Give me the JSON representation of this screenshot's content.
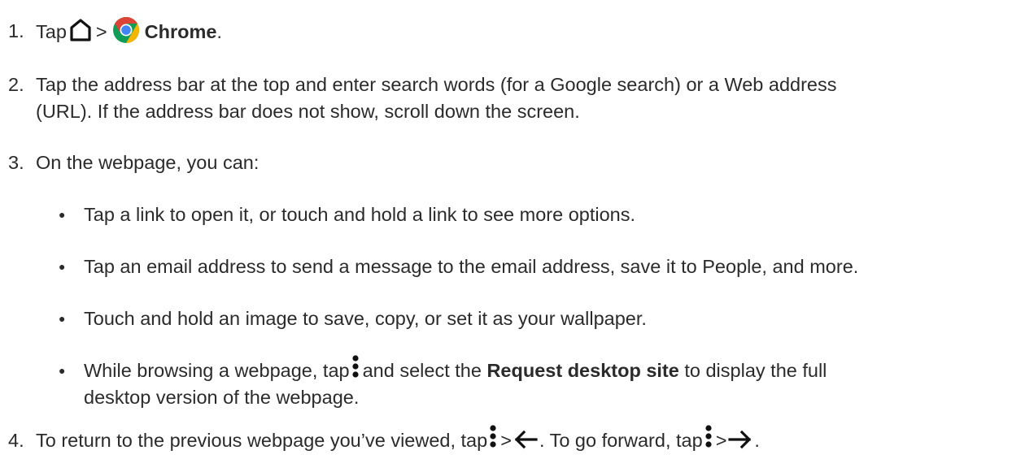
{
  "steps": [
    {
      "num": "1.",
      "tap": "Tap",
      "sep": ">",
      "app": "Chrome",
      "end": "."
    },
    {
      "num": "2.",
      "line1": "Tap the address bar at the top and enter search words (for a Google search) or a Web address",
      "line2": "(URL). If the address bar does not show, scroll down the screen."
    },
    {
      "num": "3.",
      "intro": "On the webpage, you can:",
      "bullets": [
        {
          "dot": "●",
          "text": "Tap a link to open it, or touch and hold a link to see more options."
        },
        {
          "dot": "●",
          "text": "Tap an email address to send a message to the email address, save it to People, and more."
        },
        {
          "dot": "●",
          "text": "Touch and hold an image to save, copy, or set it as your wallpaper."
        },
        {
          "dot": "●",
          "pre": "While browsing a webpage, tap",
          "mid": "and select the",
          "bold": "Request desktop site",
          "post": "to display the full",
          "line2": "desktop version of the webpage."
        }
      ]
    },
    {
      "num": "4.",
      "pre": "To return to the previous webpage you’ve viewed, tap",
      "sep1": ">",
      "mid": ". To go forward, tap",
      "sep2": ">",
      "end": "."
    }
  ],
  "icons": {
    "home": "home-icon",
    "chrome": "chrome-icon",
    "menu": "three-dot-menu-icon",
    "back": "back-arrow-icon",
    "forward": "forward-arrow-icon"
  },
  "colors": {
    "text": "#2b2b2b",
    "icon": "#111111",
    "chrome_red": "#db4437",
    "chrome_yellow": "#f4b400",
    "chrome_green": "#0f9d58",
    "chrome_blue": "#4285f4"
  }
}
